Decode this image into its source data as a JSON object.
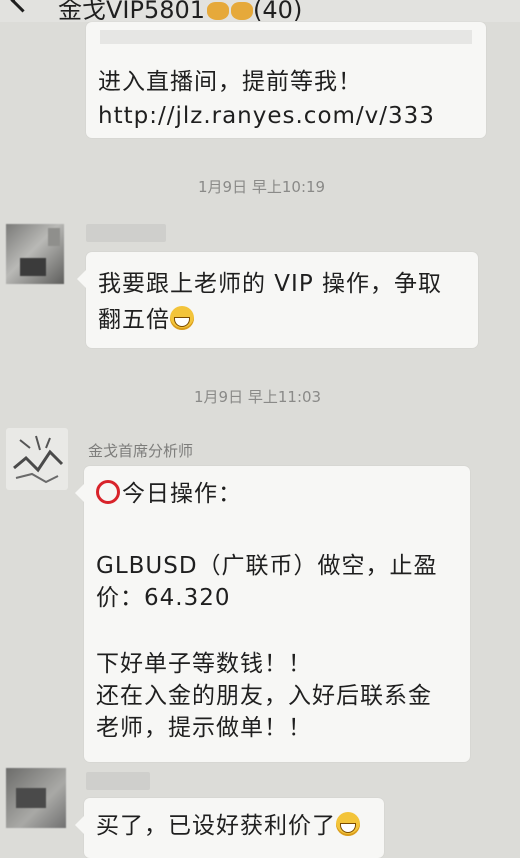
{
  "header": {
    "title": "金戈VIP5801",
    "count": "(40)"
  },
  "messages": {
    "m1": {
      "line1": "进入直播间，提前等我！",
      "line2": "http://jlz.ranyes.com/v/333"
    },
    "ts1": "1月9日 早上10:19",
    "m2": {
      "line1": "我要跟上老师的 VIP 操作，争取",
      "line2": "翻五倍"
    },
    "ts2": "1月9日 早上11:03",
    "m3": {
      "sender": "金戈首席分析师",
      "line1": "今日操作：",
      "line2": "GLBUSD（广联币）做空，止盈",
      "line3": "价：64.320",
      "line4": "下好单子等数钱！！",
      "line5": "还在入金的朋友，入好后联系金",
      "line6": "老师，提示做单！！"
    },
    "m4": {
      "line1": "买了，已设好获利价了"
    }
  },
  "icons": {
    "back": "chevron-left-icon",
    "emoji_cat": "cat-face-emoji",
    "emoji_grin": "grinning-face-emoji",
    "red_circle": "hollow-red-circle-icon"
  },
  "colors": {
    "background": "#dcdcd8",
    "bubble": "#f7f7f5",
    "timestamp": "#8a8a88",
    "red_circle": "#d8232a"
  }
}
